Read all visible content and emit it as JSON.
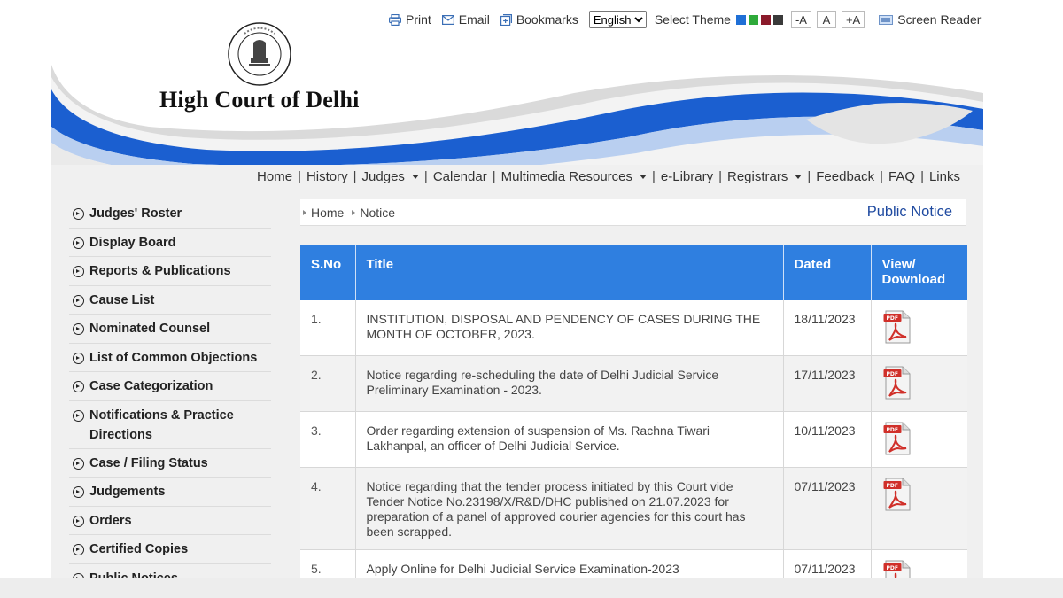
{
  "toolbar": {
    "print_label": "Print",
    "email_label": "Email",
    "bookmarks_label": "Bookmarks",
    "language_selected": "English",
    "theme_label": "Select Theme",
    "theme_colors": [
      "#1f6fd6",
      "#2eaa3a",
      "#8b1a2b",
      "#3a3a3a"
    ],
    "font_decrease": "-A",
    "font_normal": "A",
    "font_increase": "+A",
    "screen_reader_label": "Screen Reader"
  },
  "header": {
    "site_title": "High Court of Delhi",
    "accent_color": "#1b5fd0"
  },
  "nav": {
    "items": [
      {
        "label": "Home",
        "has_dropdown": false
      },
      {
        "label": "History",
        "has_dropdown": false
      },
      {
        "label": "Judges",
        "has_dropdown": true
      },
      {
        "label": "Calendar",
        "has_dropdown": false
      },
      {
        "label": "Multimedia Resources",
        "has_dropdown": true
      },
      {
        "label": "e-Library",
        "has_dropdown": false
      },
      {
        "label": "Registrars",
        "has_dropdown": true
      },
      {
        "label": "Feedback",
        "has_dropdown": false
      },
      {
        "label": "FAQ",
        "has_dropdown": false
      },
      {
        "label": "Links",
        "has_dropdown": false
      }
    ]
  },
  "sidebar": {
    "items": [
      {
        "label": "Judges' Roster"
      },
      {
        "label": "Display Board"
      },
      {
        "label": "Reports & Publications"
      },
      {
        "label": "Cause List"
      },
      {
        "label": "Nominated Counsel"
      },
      {
        "label": "List of Common Objections"
      },
      {
        "label": "Case Categorization"
      },
      {
        "label": "Notifications & Practice Directions"
      },
      {
        "label": "Case / Filing Status"
      },
      {
        "label": "Judgements"
      },
      {
        "label": "Orders"
      },
      {
        "label": "Certified Copies"
      },
      {
        "label": "Public Notices"
      }
    ]
  },
  "breadcrumb": {
    "items": [
      "Home",
      "Notice"
    ],
    "page_title": "Public Notice"
  },
  "table": {
    "header_color": "#2f7fe0",
    "headers": {
      "sno": "S.No",
      "title": "Title",
      "dated": "Dated",
      "view": "View/ Download"
    },
    "rows": [
      {
        "sno": "1.",
        "title": "INSTITUTION, DISPOSAL AND PENDENCY OF CASES DURING THE MONTH OF OCTOBER, 2023.",
        "dated": "18/11/2023"
      },
      {
        "sno": "2.",
        "title": "Notice regarding re-scheduling the date of Delhi Judicial Service Preliminary Examination - 2023.",
        "dated": "17/11/2023"
      },
      {
        "sno": "3.",
        "title": "Order regarding extension of suspension of Ms. Rachna Tiwari Lakhanpal, an officer of Delhi Judicial Service.",
        "dated": "10/11/2023"
      },
      {
        "sno": "4.",
        "title": "Notice regarding that the tender process initiated by this Court vide Tender Notice No.23198/X/R&D/DHC published on 21.07.2023 for preparation of a panel of approved courier agencies for this court has been scrapped.",
        "dated": "07/11/2023"
      },
      {
        "sno": "5.",
        "title": "Apply Online for Delhi Judicial Service Examination-2023",
        "dated": "07/11/2023"
      }
    ]
  }
}
